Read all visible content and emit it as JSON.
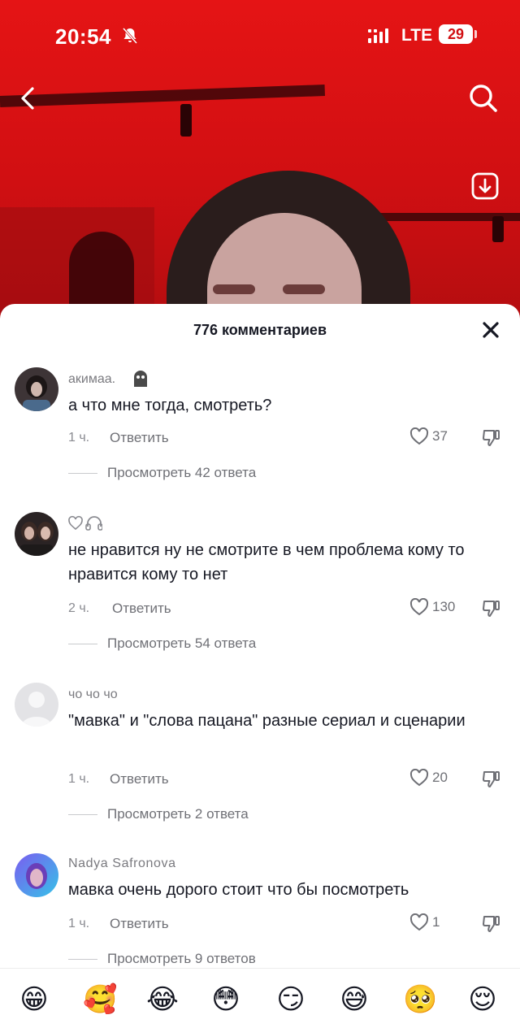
{
  "status_bar": {
    "time": "20:54",
    "network": "LTE",
    "battery": "29"
  },
  "sheet": {
    "title": "776 комментариев"
  },
  "comments": [
    {
      "username": "акимаа.",
      "text": "а что мне тогда, смотреть?",
      "time": "1 ч.",
      "reply_label": "Ответить",
      "likes": "37",
      "view_replies": "Просмотреть 42 ответа"
    },
    {
      "username": "",
      "text": "не нравится ну не смотрите в чем проблема кому то нравится кому то нет",
      "time": "2 ч.",
      "reply_label": "Ответить",
      "likes": "130",
      "view_replies": "Просмотреть 54 ответа"
    },
    {
      "username": "чо чо чо",
      "text": "\"мавка\" и \"слова пацана\" разные сериал и сценарии",
      "time": "1 ч.",
      "reply_label": "Ответить",
      "likes": "20",
      "view_replies": "Просмотреть 2 ответа"
    },
    {
      "username": "Nadya Safronova",
      "text": "мавка очень дорого стоит что бы посмотреть",
      "time": "1 ч.",
      "reply_label": "Ответить",
      "likes": "1",
      "view_replies": "Просмотреть 9 ответов"
    }
  ],
  "emoji_bar": [
    "😁",
    "🥰",
    "😂",
    "😳",
    "😏",
    "😅",
    "🥺",
    "😌"
  ],
  "colors": {
    "video_red": "#e51415",
    "text": "#161823",
    "muted": "#8a8b91"
  }
}
